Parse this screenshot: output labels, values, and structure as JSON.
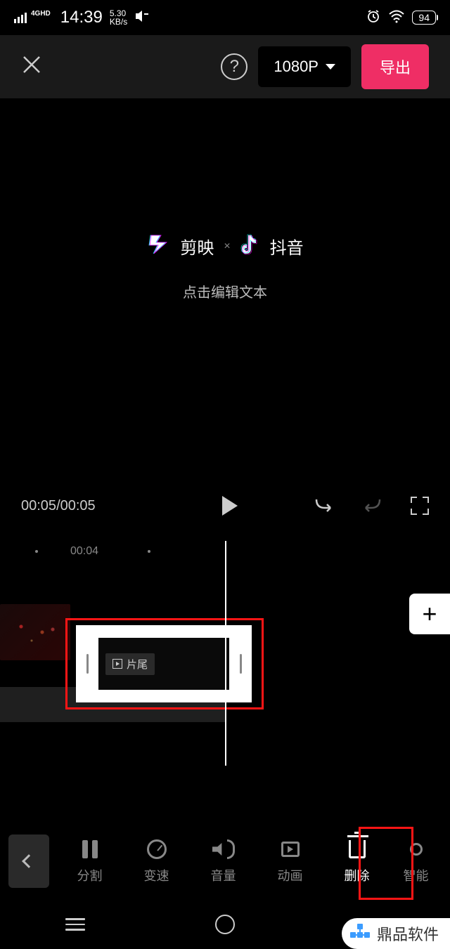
{
  "statusBar": {
    "network": "4GHD",
    "time": "14:39",
    "dataRate": "5.30",
    "dataUnit": "KB/s",
    "battery": "94"
  },
  "topBar": {
    "resolution": "1080P",
    "exportLabel": "导出"
  },
  "preview": {
    "brandA": "剪映",
    "brandB": "抖音",
    "separator": "×",
    "editHint": "点击编辑文本"
  },
  "playback": {
    "currentTime": "00:05",
    "totalTime": "00:05"
  },
  "timeline": {
    "rulerTime": "00:04",
    "endClipLabel": "片尾"
  },
  "tools": {
    "split": "分割",
    "speed": "变速",
    "volume": "音量",
    "animation": "动画",
    "delete": "删除",
    "smart": "智能"
  },
  "watermark": "鼎品软件"
}
